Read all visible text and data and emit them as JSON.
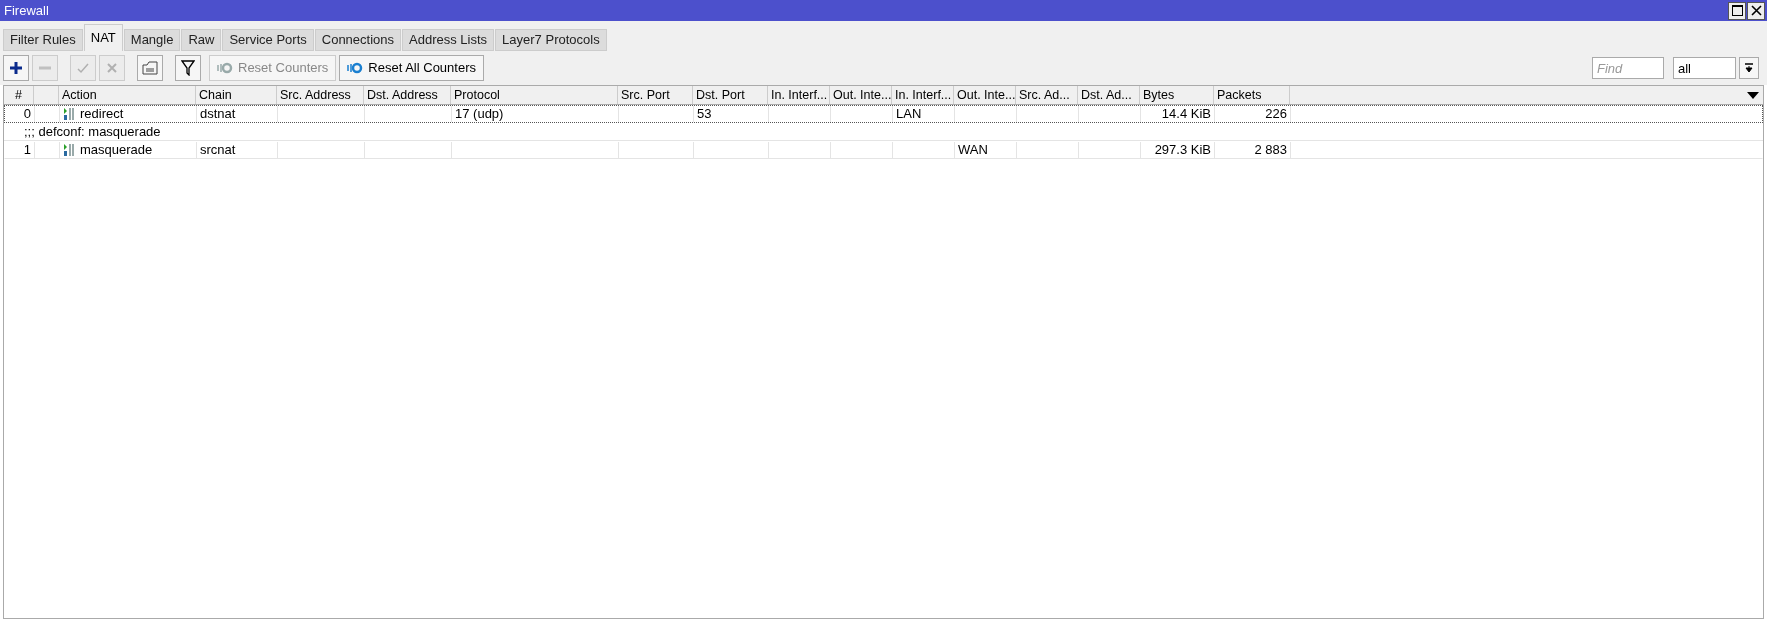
{
  "window": {
    "title": "Firewall"
  },
  "tabs": [
    {
      "label": "Filter Rules",
      "selected": false
    },
    {
      "label": "NAT",
      "selected": true
    },
    {
      "label": "Mangle",
      "selected": false
    },
    {
      "label": "Raw",
      "selected": false
    },
    {
      "label": "Service Ports",
      "selected": false
    },
    {
      "label": "Connections",
      "selected": false
    },
    {
      "label": "Address Lists",
      "selected": false
    },
    {
      "label": "Layer7 Protocols",
      "selected": false
    }
  ],
  "toolbar": {
    "icon_buttons": [
      {
        "kind": "add",
        "disabled": false
      },
      {
        "kind": "remove",
        "disabled": true
      },
      {
        "kind": "enable",
        "disabled": true
      },
      {
        "kind": "disable",
        "disabled": true
      },
      {
        "kind": "comment",
        "disabled": false
      },
      {
        "kind": "filter",
        "disabled": false
      }
    ],
    "text_buttons": [
      {
        "label": "Reset Counters",
        "disabled": true
      },
      {
        "label": "Reset All Counters",
        "disabled": false
      }
    ],
    "find": {
      "placeholder": "Find"
    },
    "scope": {
      "value": "all"
    }
  },
  "table": {
    "columns": [
      "#",
      "",
      "Action",
      "Chain",
      "Src. Address",
      "Dst. Address",
      "Protocol",
      "Src. Port",
      "Dst. Port",
      "In. Interf...",
      "Out. Inte...",
      "In. Interf...",
      "Out. Inte...",
      "Src. Ad...",
      "Dst. Ad...",
      "Bytes",
      "Packets"
    ],
    "rows": [
      {
        "kind": "rule",
        "selected": true,
        "cells": [
          "0",
          "",
          "redirect",
          "dstnat",
          "",
          "",
          "17 (udp)",
          "",
          "53",
          "",
          "",
          "LAN",
          "",
          "",
          "",
          "14.4 KiB",
          "226"
        ]
      },
      {
        "kind": "comment",
        "text": ";;; defconf: masquerade"
      },
      {
        "kind": "rule",
        "selected": false,
        "cells": [
          "1",
          "",
          "masquerade",
          "srcnat",
          "",
          "",
          "",
          "",
          "",
          "",
          "",
          "",
          "WAN",
          "",
          "",
          "297.3 KiB",
          "2 883"
        ]
      }
    ]
  }
}
